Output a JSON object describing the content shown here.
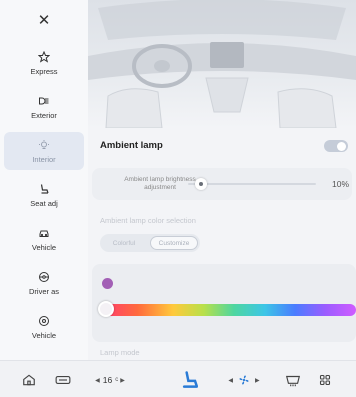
{
  "sidebar": {
    "close_glyph": "✕",
    "items": [
      {
        "label": "Express",
        "icon": "star-icon"
      },
      {
        "label": "Exterior",
        "icon": "headlight-icon"
      },
      {
        "label": "Interior",
        "icon": "lamp-icon"
      },
      {
        "label": "Seat adj",
        "icon": "seat-icon"
      },
      {
        "label": "Vehicle",
        "icon": "car-icon"
      },
      {
        "label": "Driver as",
        "icon": "steering-icon"
      },
      {
        "label": "Vehicle",
        "icon": "info-icon"
      }
    ],
    "active_index": 2
  },
  "main": {
    "ambient_lamp_title": "Ambient lamp",
    "ambient_lamp_on": false,
    "brightness_label": "Ambient lamp brightness adjustment",
    "brightness_value": "10%",
    "brightness_fraction": 0.1,
    "color_selection_title": "Ambient lamp color selection",
    "color_modes": [
      "Colorful",
      "Customize"
    ],
    "selected_color_mode": "Customize",
    "selected_color": "#a25fb5",
    "lamp_mode_title": "Lamp mode"
  },
  "bottombar": {
    "temperature": "16",
    "temp_unit_glyph": "c"
  },
  "colors": {
    "accent": "#a25fb5",
    "active_nav": "#e3e8f2"
  }
}
